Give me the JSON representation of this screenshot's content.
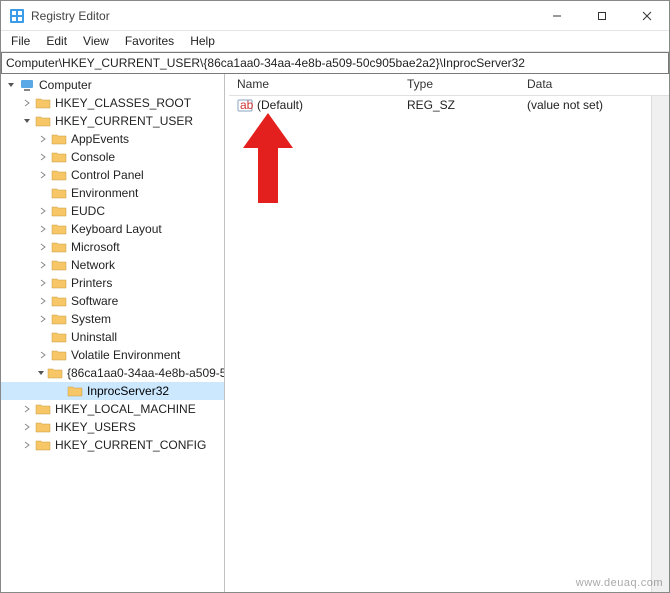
{
  "window": {
    "title": "Registry Editor"
  },
  "menu": {
    "items": [
      "File",
      "Edit",
      "View",
      "Favorites",
      "Help"
    ]
  },
  "address": {
    "path": "Computer\\HKEY_CURRENT_USER\\{86ca1aa0-34aa-4e8b-a509-50c905bae2a2}\\InprocServer32"
  },
  "tree": {
    "root": "Computer",
    "hkcr": "HKEY_CLASSES_ROOT",
    "hkcu": "HKEY_CURRENT_USER",
    "hkcu_children": [
      "AppEvents",
      "Console",
      "Control Panel",
      "Environment",
      "EUDC",
      "Keyboard Layout",
      "Microsoft",
      "Network",
      "Printers",
      "Software",
      "System",
      "Uninstall",
      "Volatile Environment"
    ],
    "guid_key": "{86ca1aa0-34aa-4e8b-a509-5",
    "inproc": "InprocServer32",
    "hklm": "HKEY_LOCAL_MACHINE",
    "hku": "HKEY_USERS",
    "hkcc": "HKEY_CURRENT_CONFIG"
  },
  "columns": {
    "name": "Name",
    "type": "Type",
    "data": "Data"
  },
  "values": [
    {
      "name": "(Default)",
      "type": "REG_SZ",
      "data": "(value not set)"
    }
  ],
  "watermark": "www.deuaq.com"
}
